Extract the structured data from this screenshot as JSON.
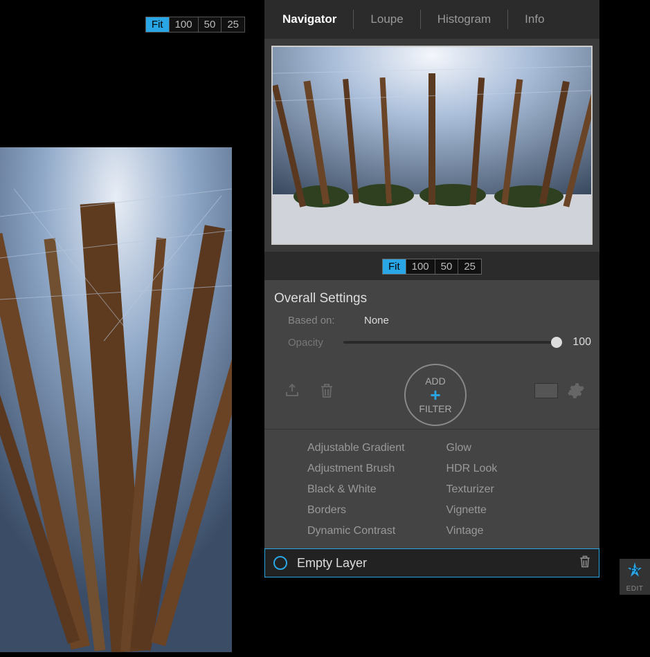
{
  "zoom_main": {
    "fit": "Fit",
    "z100": "100",
    "z50": "50",
    "z25": "25"
  },
  "nav_tabs": {
    "navigator": "Navigator",
    "loupe": "Loupe",
    "histogram": "Histogram",
    "info": "Info"
  },
  "zoom_nav": {
    "fit": "Fit",
    "z100": "100",
    "z50": "50",
    "z25": "25"
  },
  "settings": {
    "title": "Overall Settings",
    "based_on_label": "Based on:",
    "based_on_value": "None",
    "opacity_label": "Opacity",
    "opacity_value": "100",
    "add_top": "ADD",
    "add_bottom": "FILTER"
  },
  "filters_left": {
    "f0": "Adjustable Gradient",
    "f1": "Adjustment Brush",
    "f2": "Black & White",
    "f3": "Borders",
    "f4": "Dynamic Contrast"
  },
  "filters_right": {
    "f0": "Glow",
    "f1": "HDR Look",
    "f2": "Texturizer",
    "f3": "Vignette",
    "f4": "Vintage"
  },
  "layer": {
    "label": "Empty Layer"
  },
  "fx": {
    "label": "EDIT"
  }
}
